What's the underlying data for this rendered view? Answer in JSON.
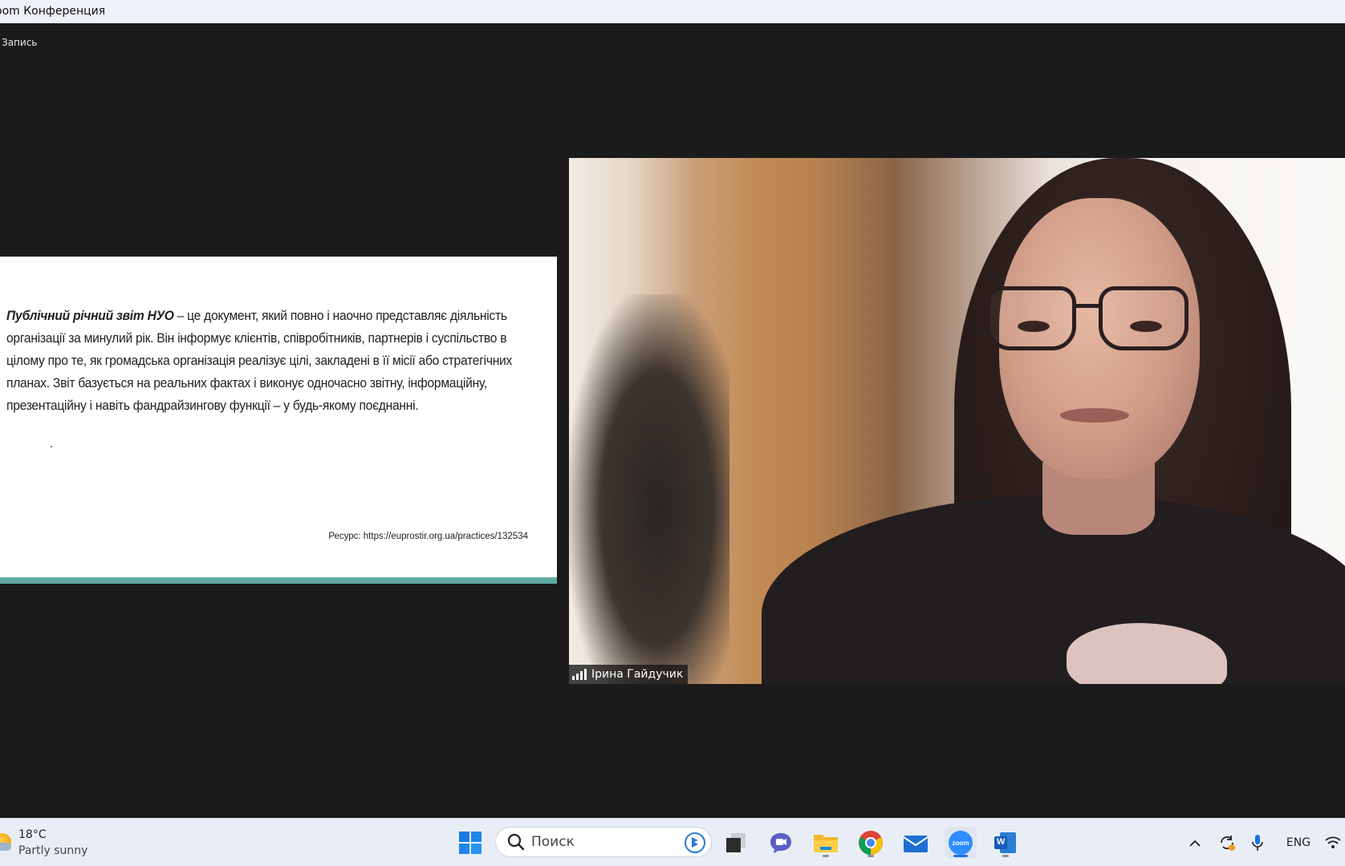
{
  "window": {
    "title": "oom Конференция"
  },
  "meeting": {
    "recording_label": "Запись",
    "slide": {
      "term": "Публічний річний звіт НУО",
      "definition": " – це документ, який повно і наочно представляє діяльність організації за минулий рік. Він інформує клієнтів, співробітників, партнерів і суспільство в цілому про те, як громадська організація реалізує цілі, закладені в її місії або стратегічних планах. Звіт базується на реальних фактах і виконує одночасно звітну, інформаційну, презентаційну і навіть фандрайзингову функції –  у будь-якому поєднанні.",
      "source": "Ресурс: https://euprostir.org.ua/practices/132534",
      "accent_color": "#5fa9a2"
    },
    "participant": {
      "name": "Ірина Гайдучик"
    }
  },
  "taskbar": {
    "weather": {
      "temp": "18°C",
      "desc": "Partly sunny"
    },
    "search": {
      "placeholder": "Поиск"
    },
    "apps": [
      {
        "name": "start",
        "icon": "windows-logo-icon"
      },
      {
        "name": "task-view",
        "icon": "task-view-icon"
      },
      {
        "name": "teams-chat",
        "icon": "chat-icon"
      },
      {
        "name": "file-explorer",
        "icon": "folder-icon"
      },
      {
        "name": "chrome",
        "icon": "chrome-icon"
      },
      {
        "name": "mail",
        "icon": "mail-icon"
      },
      {
        "name": "zoom",
        "icon": "zoom-icon",
        "label": "zoom"
      },
      {
        "name": "word",
        "icon": "word-icon",
        "label": "W"
      }
    ],
    "tray": {
      "language": "ENG"
    }
  }
}
